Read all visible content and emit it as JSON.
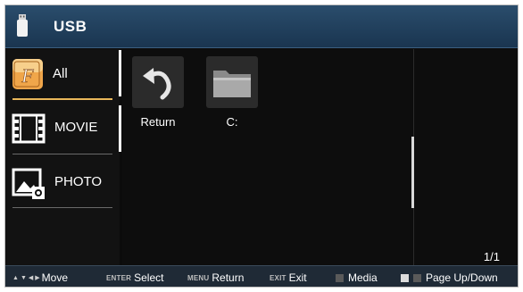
{
  "header": {
    "title": "USB",
    "icon": "usb-drive-icon"
  },
  "sidebar": {
    "items": [
      {
        "label": "All",
        "icon": "all-files-icon",
        "active": true
      },
      {
        "label": "MOVIE",
        "icon": "film-icon",
        "active": false
      },
      {
        "label": "PHOTO",
        "icon": "photo-icon",
        "active": false
      }
    ]
  },
  "grid": {
    "items": [
      {
        "label": "Return",
        "icon": "return-arrow-icon"
      },
      {
        "label": "C:",
        "icon": "folder-icon"
      }
    ]
  },
  "page_indicator": "1/1",
  "footer": {
    "move": "Move",
    "enter_key": "ENTER",
    "select": "Select",
    "menu_key": "MENU",
    "return": "Return",
    "exit_key": "EXIT",
    "exit": "Exit",
    "media": "Media",
    "page": "Page Up/Down"
  },
  "colors": {
    "header": "#1f3e5c",
    "accent": "#e8b75a",
    "footer": "#1f2a36"
  }
}
